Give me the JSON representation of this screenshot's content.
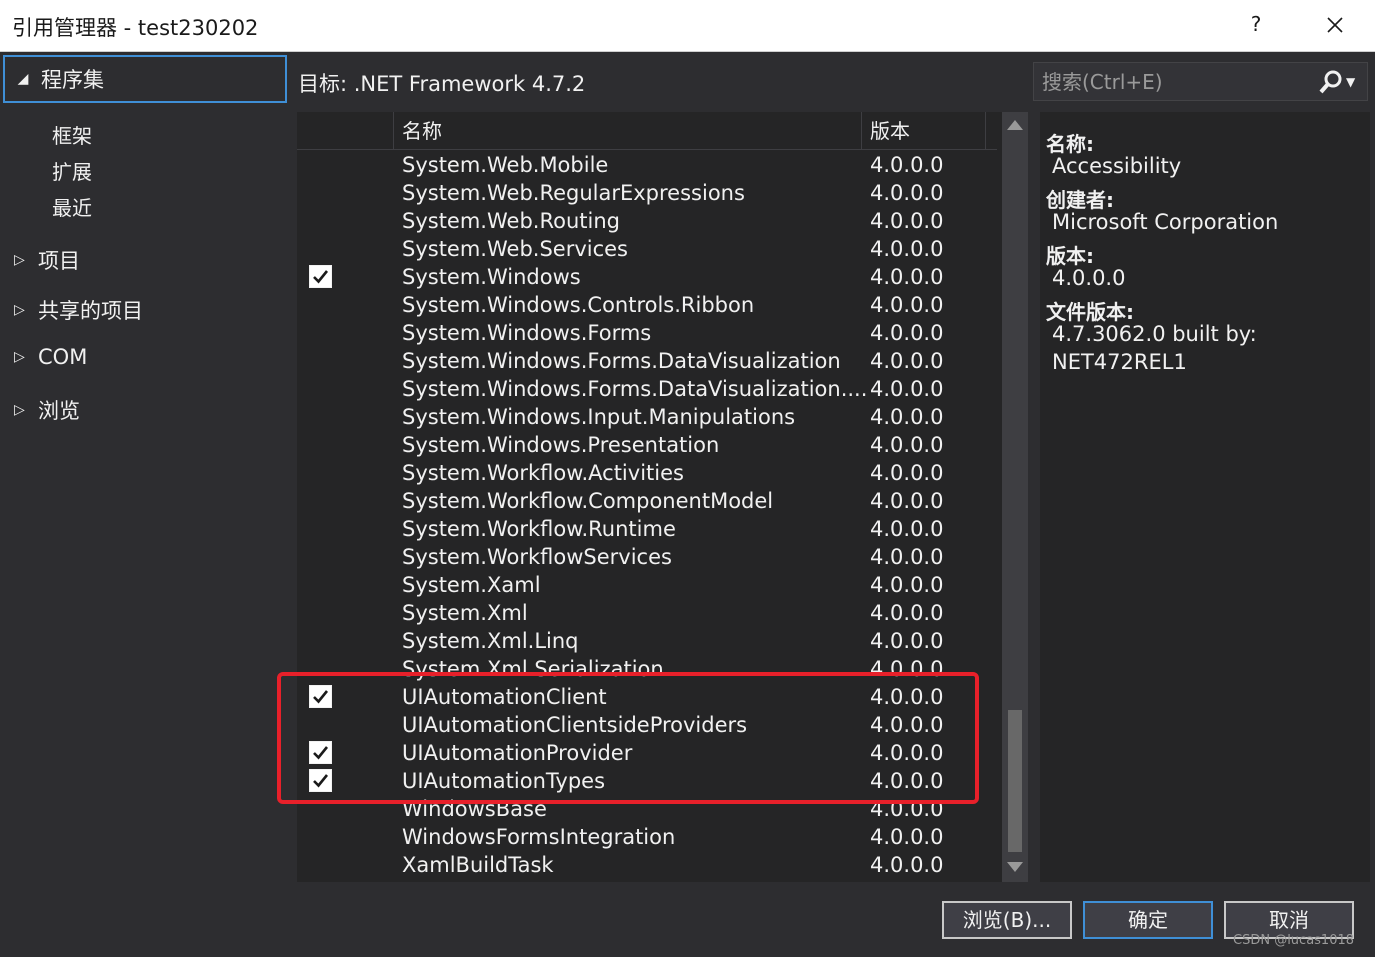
{
  "window": {
    "title": "引用管理器 - test230202",
    "help": "?"
  },
  "leftnav": {
    "selected": {
      "label": "程序集",
      "expanded": true
    },
    "sub_items": [
      "框架",
      "扩展",
      "最近"
    ],
    "items": [
      "项目",
      "共享的项目",
      "COM",
      "浏览"
    ]
  },
  "target": {
    "label": "目标: .NET Framework 4.7.2"
  },
  "search": {
    "placeholder": "搜索(Ctrl+E)",
    "value": ""
  },
  "list": {
    "columns": {
      "name": "名称",
      "version": "版本"
    },
    "rows": [
      {
        "name": "System.Web.Mobile",
        "version": "4.0.0.0",
        "checked": false
      },
      {
        "name": "System.Web.RegularExpressions",
        "version": "4.0.0.0",
        "checked": false
      },
      {
        "name": "System.Web.Routing",
        "version": "4.0.0.0",
        "checked": false
      },
      {
        "name": "System.Web.Services",
        "version": "4.0.0.0",
        "checked": false
      },
      {
        "name": "System.Windows",
        "version": "4.0.0.0",
        "checked": true
      },
      {
        "name": "System.Windows.Controls.Ribbon",
        "version": "4.0.0.0",
        "checked": false
      },
      {
        "name": "System.Windows.Forms",
        "version": "4.0.0.0",
        "checked": false
      },
      {
        "name": "System.Windows.Forms.DataVisualization",
        "version": "4.0.0.0",
        "checked": false
      },
      {
        "name": "System.Windows.Forms.DataVisualization....",
        "version": "4.0.0.0",
        "checked": false
      },
      {
        "name": "System.Windows.Input.Manipulations",
        "version": "4.0.0.0",
        "checked": false
      },
      {
        "name": "System.Windows.Presentation",
        "version": "4.0.0.0",
        "checked": false
      },
      {
        "name": "System.Workflow.Activities",
        "version": "4.0.0.0",
        "checked": false
      },
      {
        "name": "System.Workflow.ComponentModel",
        "version": "4.0.0.0",
        "checked": false
      },
      {
        "name": "System.Workflow.Runtime",
        "version": "4.0.0.0",
        "checked": false
      },
      {
        "name": "System.WorkflowServices",
        "version": "4.0.0.0",
        "checked": false
      },
      {
        "name": "System.Xaml",
        "version": "4.0.0.0",
        "checked": false
      },
      {
        "name": "System.Xml",
        "version": "4.0.0.0",
        "checked": false
      },
      {
        "name": "System.Xml.Linq",
        "version": "4.0.0.0",
        "checked": false
      },
      {
        "name": "System.Xml.Serialization",
        "version": "4.0.0.0",
        "checked": false
      },
      {
        "name": "UIAutomationClient",
        "version": "4.0.0.0",
        "checked": true
      },
      {
        "name": "UIAutomationClientsideProviders",
        "version": "4.0.0.0",
        "checked": false
      },
      {
        "name": "UIAutomationProvider",
        "version": "4.0.0.0",
        "checked": true
      },
      {
        "name": "UIAutomationTypes",
        "version": "4.0.0.0",
        "checked": true
      },
      {
        "name": "WindowsBase",
        "version": "4.0.0.0",
        "checked": false
      },
      {
        "name": "WindowsFormsIntegration",
        "version": "4.0.0.0",
        "checked": false
      },
      {
        "name": "XamlBuildTask",
        "version": "4.0.0.0",
        "checked": false
      }
    ]
  },
  "details": {
    "name_label": "名称:",
    "name_value": "Accessibility",
    "creator_label": "创建者:",
    "creator_value": "Microsoft Corporation",
    "version_label": "版本:",
    "version_value": "4.0.0.0",
    "file_version_label": "文件版本:",
    "file_version_line1": "4.7.3062.0 built by:",
    "file_version_line2": "NET472REL1"
  },
  "buttons": {
    "browse": "浏览(B)...",
    "ok": "确定",
    "cancel": "取消"
  },
  "watermark": "CSDN @lucas1018",
  "colors": {
    "background": "#2d2d30",
    "panel": "#252526",
    "accent": "#3f8fd6",
    "highlight": "#e8202a"
  }
}
